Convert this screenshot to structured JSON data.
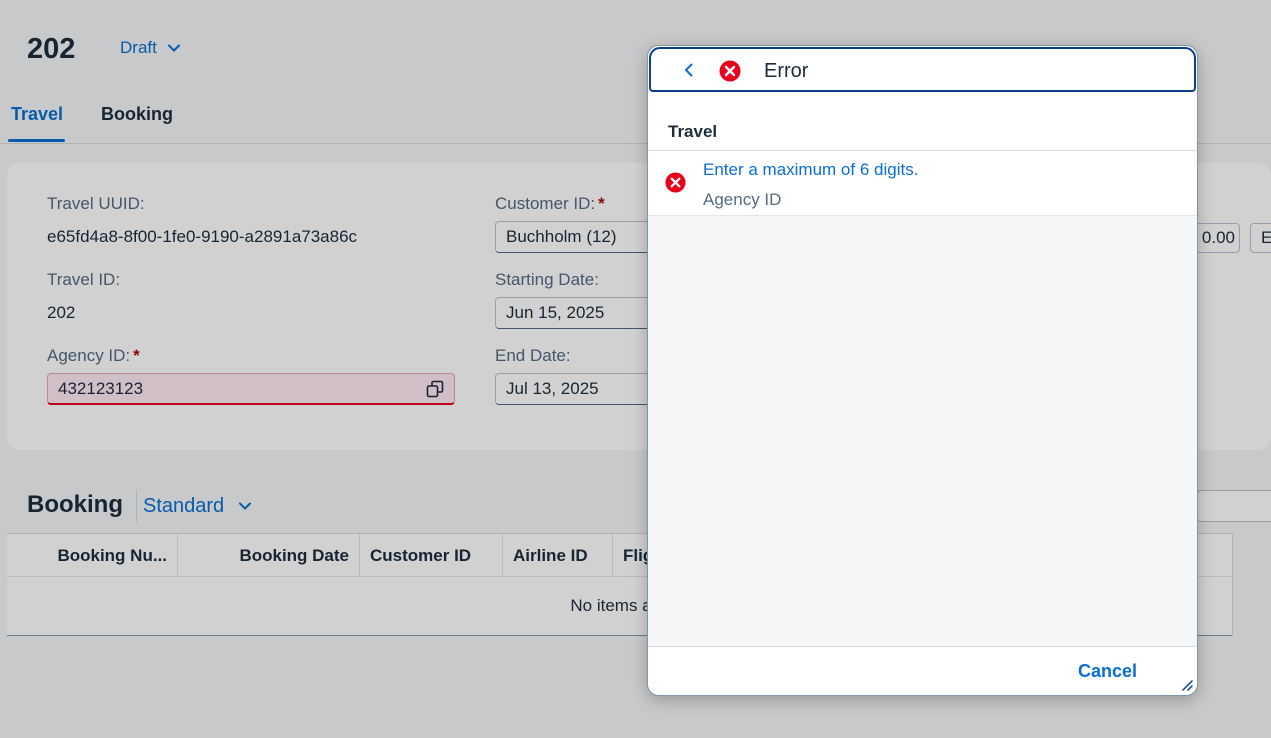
{
  "header": {
    "title": "202",
    "status": "Draft"
  },
  "tabs": [
    {
      "label": "Travel",
      "active": true
    },
    {
      "label": "Booking",
      "active": false
    }
  ],
  "form": {
    "travel_uuid": {
      "label": "Travel UUID:",
      "value": "e65fd4a8-8f00-1fe0-9190-a2891a73a86c"
    },
    "travel_id": {
      "label": "Travel ID:",
      "value": "202"
    },
    "agency_id": {
      "label": "Agency ID:",
      "required": "*",
      "value": "432123123",
      "state": "error"
    },
    "customer_id": {
      "label": "Customer ID:",
      "required": "*",
      "value": "Buchholm (12)"
    },
    "starting_date": {
      "label": "Starting Date:",
      "value": "Jun 15, 2025"
    },
    "end_date": {
      "label": "End Date:",
      "value": "Jul 13, 2025"
    },
    "edge_amount": "0.00",
    "edge_currency": "E"
  },
  "booking": {
    "title": "Booking",
    "variant": "Standard",
    "columns": [
      "Booking Nu...",
      "Booking Date",
      "Customer ID",
      "Airline ID",
      "Flig"
    ],
    "no_items": "No items ava"
  },
  "message_popover": {
    "title": "Error",
    "group": "Travel",
    "messages": [
      {
        "text": "Enter a maximum of 6 digits.",
        "subtitle": "Agency ID",
        "type": "error"
      }
    ],
    "cancel_label": "Cancel"
  },
  "colors": {
    "accent": "#0a6ed1",
    "error": "#e9001b",
    "header_border": "#0a3e8a"
  }
}
